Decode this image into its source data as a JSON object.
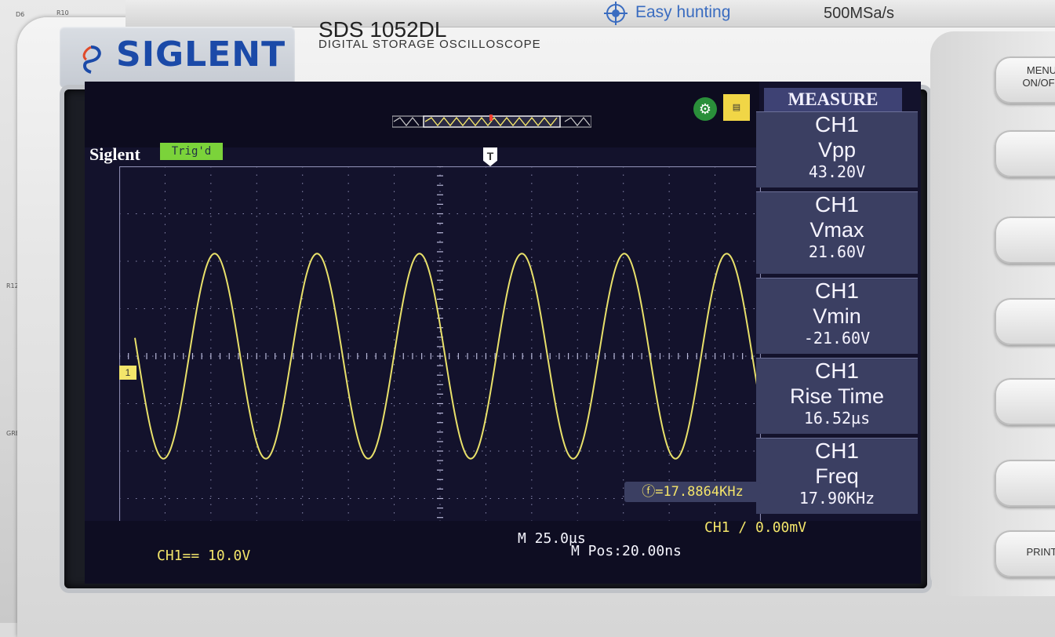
{
  "device": {
    "brand_logo": "SIGLENT",
    "model": "SDS 1052DL",
    "subtitle": "DIGITAL STORAGE OSCILLOSCOPE",
    "feature": "Easy hunting",
    "sample_rate": "500MSa/s"
  },
  "screen": {
    "brand": "Siglent",
    "trigger_status": "Trig'd",
    "trigger_marker": "T",
    "channel_marker": "1",
    "measure_title": "MEASURE",
    "measurements": [
      {
        "ch": "CH1",
        "name": "Vpp",
        "value": "43.20V"
      },
      {
        "ch": "CH1",
        "name": "Vmax",
        "value": "21.60V"
      },
      {
        "ch": "CH1",
        "name": "Vmin",
        "value": "-21.60V"
      },
      {
        "ch": "CH1",
        "name": "Rise Time",
        "value": "16.52µs"
      },
      {
        "ch": "CH1",
        "name": "Freq",
        "value": "17.90KHz"
      }
    ],
    "cursor_freq": "ⓕ=17.8864KHz",
    "ch1_scale": "CH1== 10.0V",
    "timebase": "M 25.0µs",
    "mpos": "M Pos:20.00ns",
    "trigger_level": "CH1 ∕ 0.00mV"
  },
  "side_buttons": {
    "menu": "MENU ON/OFF",
    "print": "PRINT"
  },
  "waveform": {
    "amplitude_v": 21.6,
    "frequency_khz": 17.9,
    "volts_per_div": 10,
    "time_per_div_us": 25,
    "color": "#e8e06a"
  },
  "colors": {
    "lcd_bg": "#13122c",
    "trace": "#e8e06a",
    "panel": "#3b3f62",
    "logo": "#1b4aa8"
  }
}
